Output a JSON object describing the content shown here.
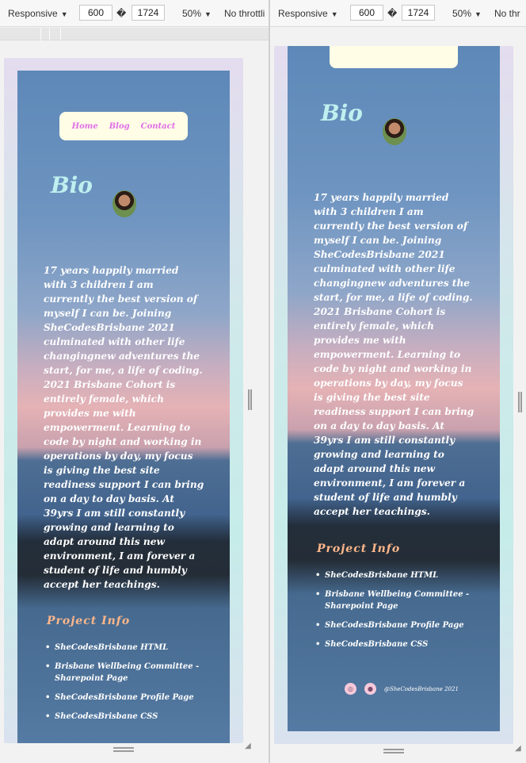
{
  "toolbar": {
    "device": "Responsive",
    "width": "600",
    "separator": "�",
    "height": "1724",
    "zoom": "50%",
    "throttle_left": "No throttli",
    "throttle_right": "No thr"
  },
  "nav": {
    "home": "Home",
    "blog": "Blog",
    "contact": "Contact"
  },
  "bio": {
    "title": "Bio",
    "lines_left": [
      "17 years happily married",
      "with 3 children I am",
      "currently the best version of",
      "myself I can be. Joining",
      "SheCodesBrisbane 2021",
      "culminated with other life",
      "changingnew adventures the",
      "start, for me, a life of coding.",
      "2021 Brisbane Cohort is",
      "entirely female, which",
      "provides me with",
      "empowerment. Learning to",
      "code by night and working in",
      "operations by day, my focus",
      "is giving the best site",
      "readiness support I can bring",
      "on a day to day basis. At",
      "39yrs I am still constantly",
      "growing and learning to",
      "adapt around this new",
      "environment, I am forever a",
      "student of life and humbly",
      "accept her teachings."
    ],
    "lines_right": [
      "17 years happily married",
      "with 3 children I am",
      "currently the best version of",
      "myself I can be. Joining",
      "SheCodesBrisbane 2021",
      "culminated with other life",
      "changingnew adventures the",
      "start, for me, a life of coding.",
      "2021 Brisbane Cohort is",
      "entirely female, which",
      "provides me with",
      "empowerment. Learning to",
      "code by night and working in",
      "operations by day, my focus",
      "is giving the best site",
      "readiness support I can bring",
      "on a day to day basis. At",
      "39yrs I am still constantly",
      "growing and learning to",
      "adapt around this new",
      "environment, I am forever a",
      "student of life and humbly",
      "accept her teachings."
    ]
  },
  "project": {
    "title": "Project Info",
    "items_left": [
      "SheCodesBrisbane HTML",
      "Brisbane Wellbeing Committee -",
      "Sharepoint Page",
      "SheCodesBrisbane Profile Page",
      "SheCodesBrisbane CSS"
    ],
    "items_right": [
      "SheCodesBrisbane HTML",
      "Brisbane Wellbeing Committee -",
      "Sharepoint Page",
      "SheCodesBrisbane Profile Page",
      "SheCodesBrisbane CSS"
    ]
  },
  "footer": {
    "github_icon": "github-icon",
    "social_icon": "social-icon",
    "credit": "@SheCodesBrisbane 2021"
  },
  "colors": {
    "nav_bg": "#fffde6",
    "nav_text": "#e06de8",
    "bio_title": "#bff0ef",
    "project_title": "#ffb78a"
  }
}
